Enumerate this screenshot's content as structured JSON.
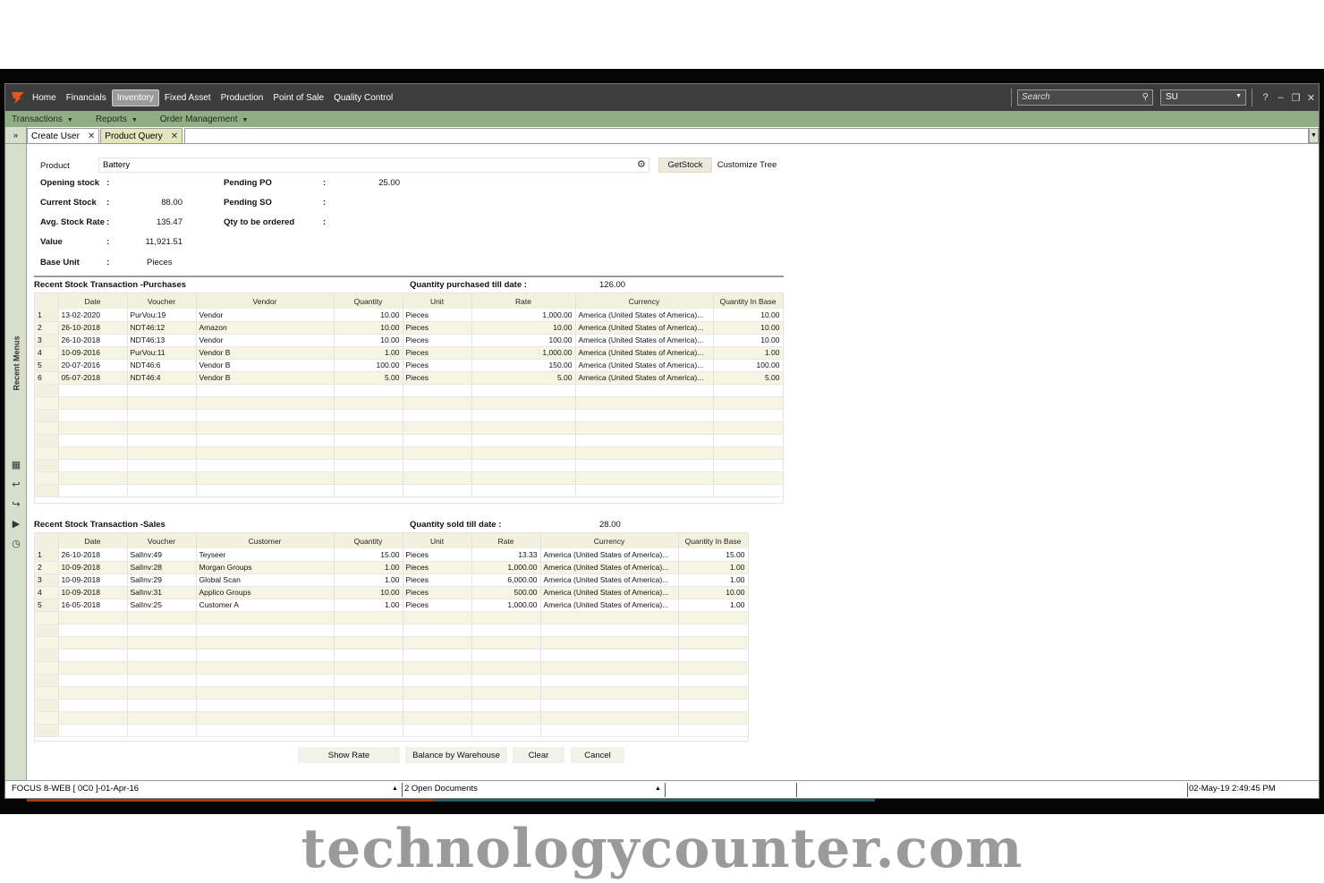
{
  "menubar": {
    "items": [
      "Home",
      "Financials",
      "Inventory",
      "Fixed Asset",
      "Production",
      "Point of Sale",
      "Quality Control"
    ],
    "active": "Inventory",
    "search_placeholder": "Search",
    "user": "SU"
  },
  "submenu": {
    "items": [
      "Transactions",
      "Reports",
      "Order Management"
    ]
  },
  "tabs": [
    {
      "label": "Create User",
      "active": false
    },
    {
      "label": "Product Query",
      "active": true
    }
  ],
  "leftrail": {
    "label": "Recent Menus"
  },
  "product": {
    "label": "Product",
    "value": "Battery",
    "getstock": "GetStock",
    "customize": "Customize Tree"
  },
  "summary": {
    "opening_stock_label": "Opening stock",
    "opening_stock": "",
    "current_stock_label": "Current Stock",
    "current_stock": "88.00",
    "avg_rate_label": "Avg. Stock Rate",
    "avg_rate": "135.47",
    "value_label": "Value",
    "value": "11,921.51",
    "base_unit_label": "Base Unit",
    "base_unit": "Pieces",
    "pending_po_label": "Pending PO",
    "pending_po": "25.00",
    "pending_so_label": "Pending SO",
    "pending_so": "",
    "qty_order_label": "Qty to be ordered",
    "qty_order": "",
    "colon": ":"
  },
  "purchases": {
    "title": "Recent Stock Transaction -Purchases",
    "total_label": "Quantity purchased till date :",
    "total": "126.00",
    "columns": [
      "Date",
      "Voucher",
      "Vendor",
      "Quantity",
      "Unit",
      "Rate",
      "Currency",
      "Quantity In Base"
    ],
    "rows": [
      [
        "1",
        "13-02-2020",
        "PurVou:19",
        "Vendor",
        "10.00",
        "Pieces",
        "1,000.00",
        "America (United States of America)...",
        "10.00"
      ],
      [
        "2",
        "26-10-2018",
        "NDT46:12",
        "Amazon",
        "10.00",
        "Pieces",
        "10.00",
        "America (United States of America)...",
        "10.00"
      ],
      [
        "3",
        "26-10-2018",
        "NDT46:13",
        "Vendor",
        "10.00",
        "Pieces",
        "100.00",
        "America (United States of America)...",
        "10.00"
      ],
      [
        "4",
        "10-09-2016",
        "PurVou:11",
        "Vendor B",
        "1.00",
        "Pieces",
        "1,000.00",
        "America (United States of America)...",
        "1.00"
      ],
      [
        "5",
        "20-07-2016",
        "NDT46:6",
        "Vendor B",
        "100.00",
        "Pieces",
        "150.00",
        "America (United States of America)...",
        "100.00"
      ],
      [
        "6",
        "05-07-2018",
        "NDT46:4",
        "Vendor B",
        "5.00",
        "Pieces",
        "5.00",
        "America (United States of America)...",
        "5.00"
      ]
    ]
  },
  "sales": {
    "title": "Recent Stock Transaction -Sales",
    "total_label": "Quantity sold till date :",
    "total": "28.00",
    "columns": [
      "Date",
      "Voucher",
      "Customer",
      "Quantity",
      "Unit",
      "Rate",
      "Currency",
      "Quantity In Base"
    ],
    "rows": [
      [
        "1",
        "26-10-2018",
        "SalInv:49",
        "Teyseer",
        "15.00",
        "Pieces",
        "13.33",
        "America (United States of America)...",
        "15.00"
      ],
      [
        "2",
        "10-09-2018",
        "SalInv:28",
        "Morgan Groups",
        "1.00",
        "Pieces",
        "1,000.00",
        "America (United States of America)...",
        "1.00"
      ],
      [
        "3",
        "10-09-2018",
        "SalInv:29",
        "Global Scan",
        "1.00",
        "Pieces",
        "6,000.00",
        "America (United States of America)...",
        "1.00"
      ],
      [
        "4",
        "10-09-2018",
        "SalInv:31",
        "Applico Groups",
        "10.00",
        "Pieces",
        "500.00",
        "America (United States of America)...",
        "10.00"
      ],
      [
        "5",
        "16-05-2018",
        "SalInv:25",
        "Customer A",
        "1.00",
        "Pieces",
        "1,000.00",
        "America (United States of America)...",
        "1.00"
      ]
    ]
  },
  "actions": {
    "show_rate": "Show Rate",
    "balance": "Balance by Warehouse",
    "clear": "Clear",
    "cancel": "Cancel"
  },
  "status": {
    "company": "FOCUS 8-WEB [ 0C0 ]-01-Apr-16",
    "open_docs": "2 Open Documents",
    "datetime": "02-May-19 2:49:45 PM"
  },
  "watermark": "technologycounter.com"
}
